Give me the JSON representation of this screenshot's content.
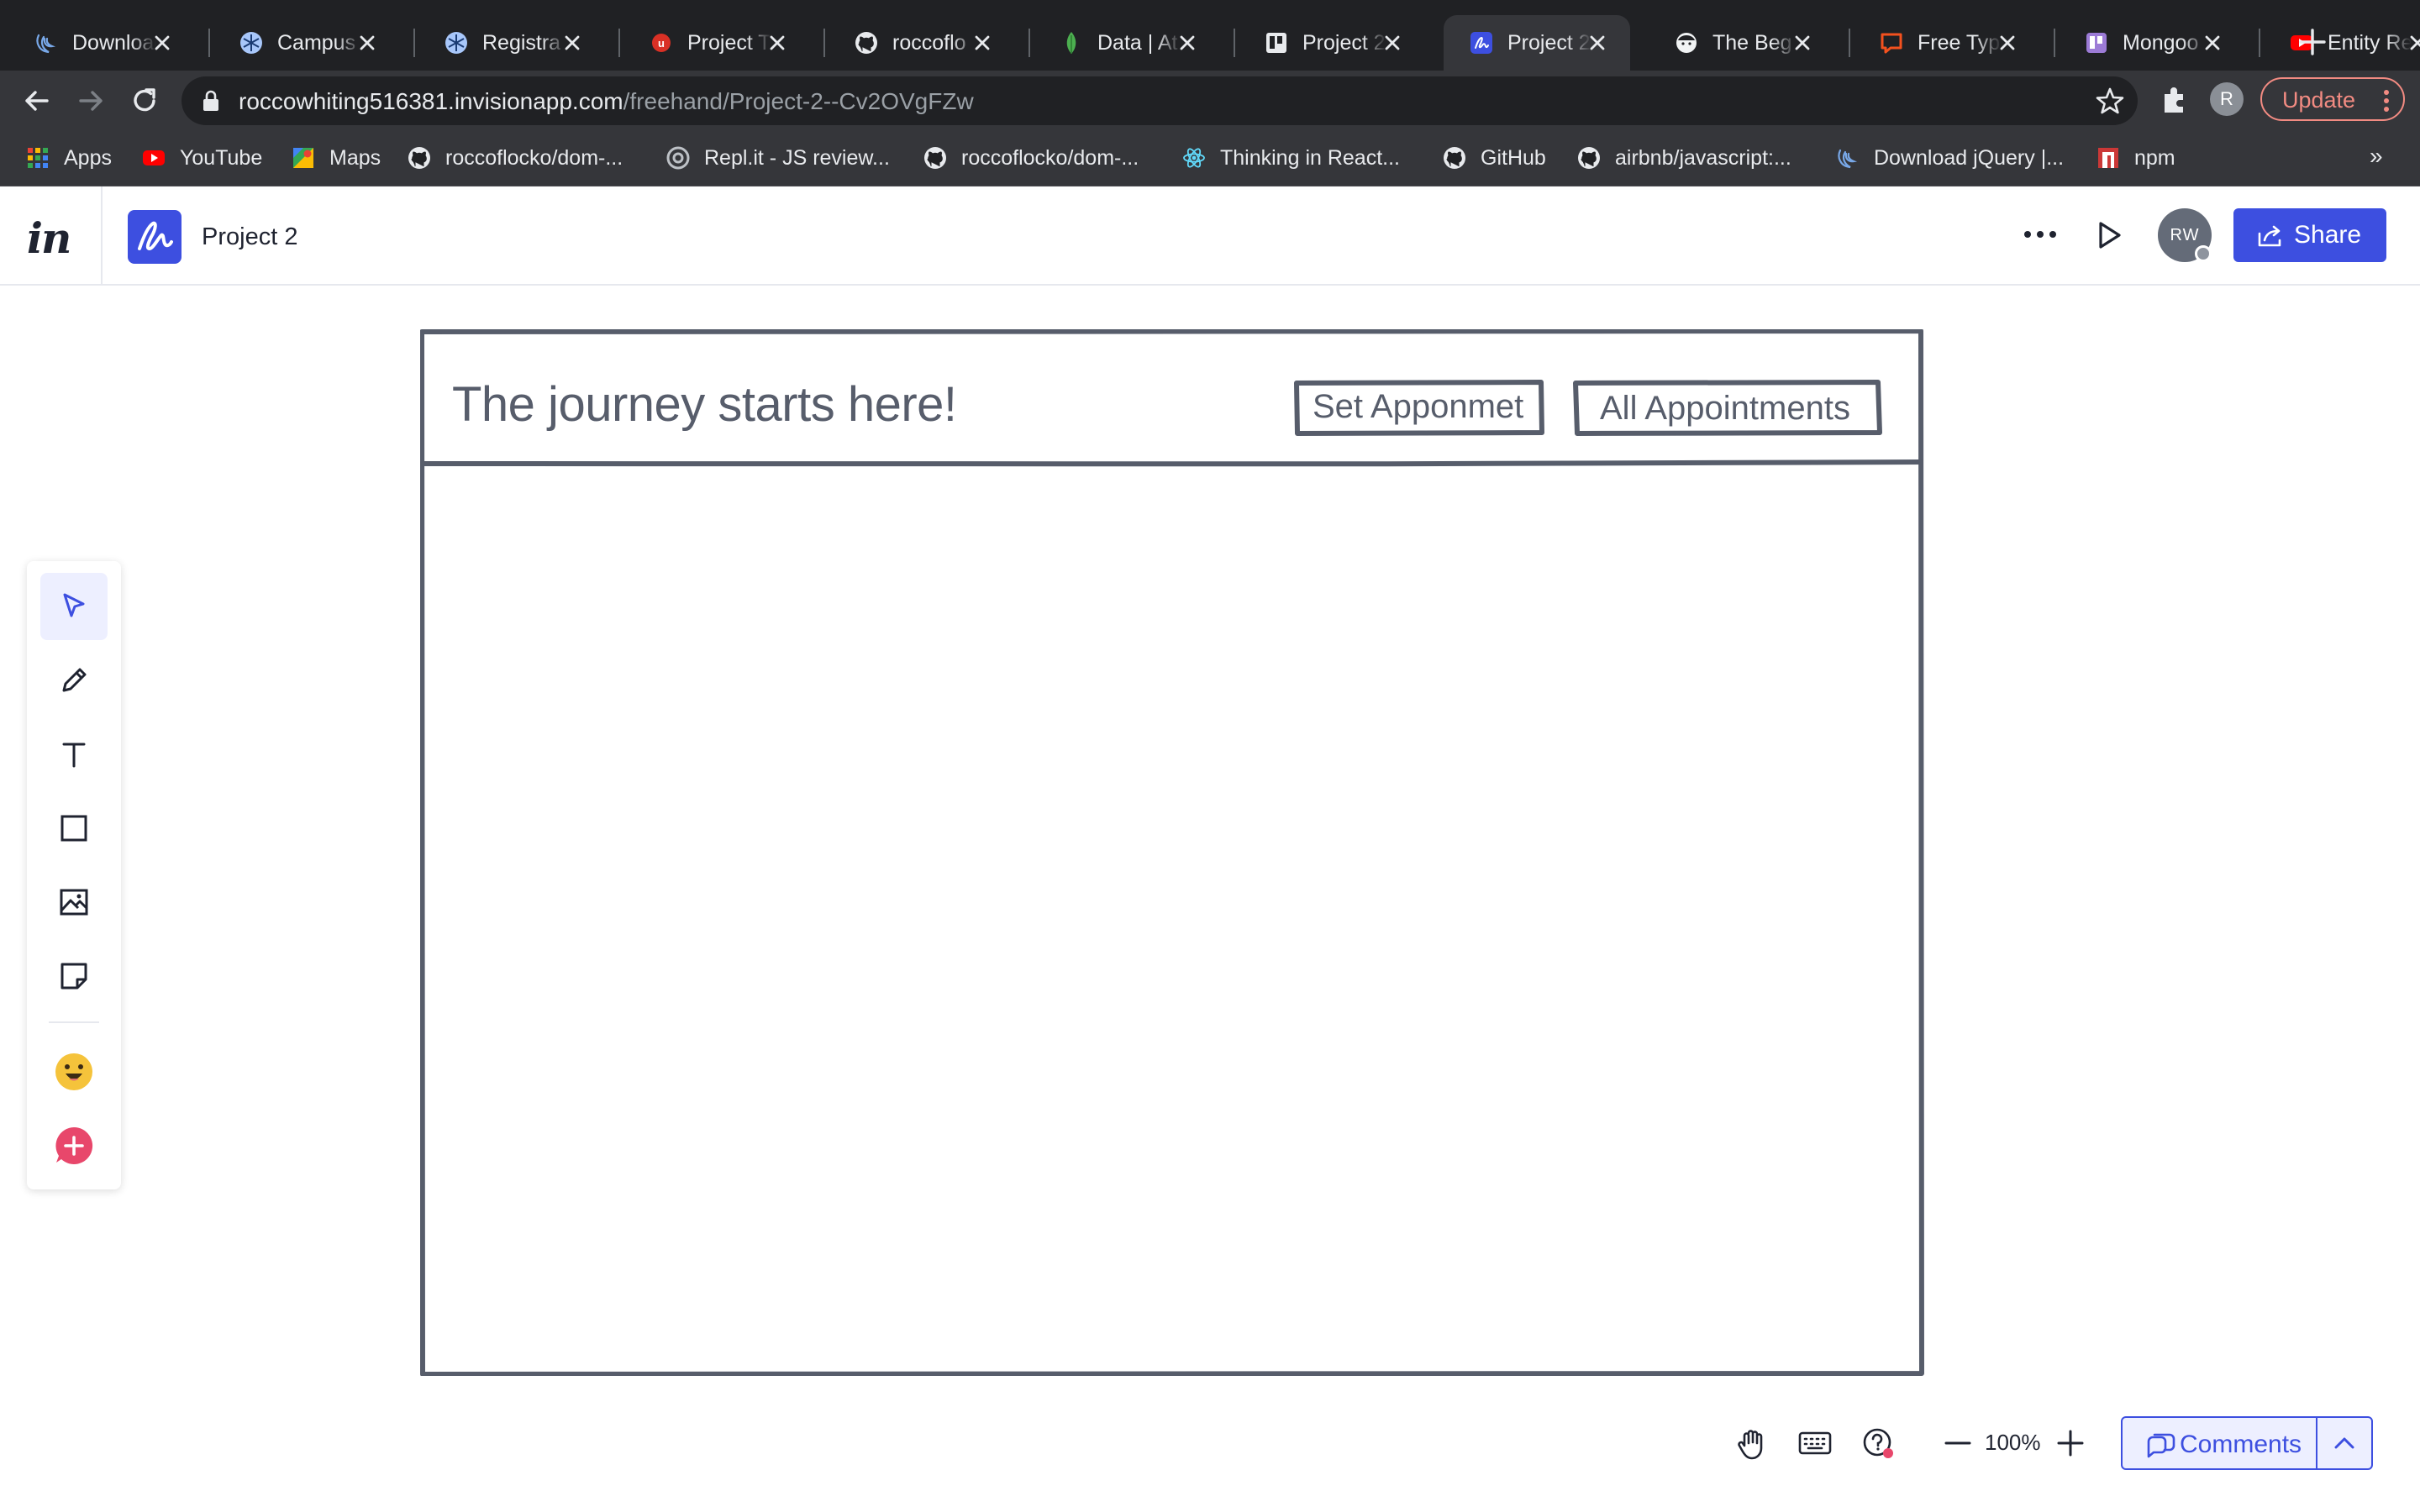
{
  "browser": {
    "tabs": [
      {
        "title": "Download",
        "icon": "jquery-icon",
        "active": false
      },
      {
        "title": "Campus",
        "icon": "snowflake-icon",
        "active": false
      },
      {
        "title": "Registra",
        "icon": "snowflake-icon",
        "active": false
      },
      {
        "title": "Project T",
        "icon": "red-circle-icon",
        "active": false
      },
      {
        "title": "roccoflo",
        "icon": "github-icon",
        "active": false
      },
      {
        "title": "Data | At",
        "icon": "mongodb-leaf-icon",
        "active": false
      },
      {
        "title": "Project 2",
        "icon": "trello-icon",
        "active": false
      },
      {
        "title": "Project 2",
        "icon": "invision-freehand-icon",
        "active": true
      },
      {
        "title": "The Beg",
        "icon": "face-icon",
        "active": false
      },
      {
        "title": "Free Typ",
        "icon": "chat-bubble-icon",
        "active": false
      },
      {
        "title": "Mongoo",
        "icon": "trello-purple-icon",
        "active": false
      },
      {
        "title": "Entity Re",
        "icon": "youtube-icon",
        "active": false
      }
    ],
    "url_domain": "roccowhiting516381.invisionapp.com",
    "url_path": "/freehand/Project-2--Cv2OVgFZw",
    "profile_initial": "R",
    "update_label": "Update",
    "bookmarks": [
      {
        "label": "Apps",
        "icon": "apps-grid-icon"
      },
      {
        "label": "YouTube",
        "icon": "youtube-icon"
      },
      {
        "label": "Maps",
        "icon": "maps-icon"
      },
      {
        "label": "roccoflocko/dom-...",
        "icon": "github-icon"
      },
      {
        "label": "Repl.it - JS review...",
        "icon": "replit-icon"
      },
      {
        "label": "roccoflocko/dom-...",
        "icon": "github-icon"
      },
      {
        "label": "Thinking in React...",
        "icon": "react-icon"
      },
      {
        "label": "GitHub",
        "icon": "github-icon"
      },
      {
        "label": "airbnb/javascript:...",
        "icon": "github-icon"
      },
      {
        "label": "Download jQuery |...",
        "icon": "jquery-icon"
      },
      {
        "label": "npm",
        "icon": "npm-icon"
      }
    ],
    "bookmarks_overflow": "»"
  },
  "app": {
    "logo_text": "in",
    "doc_title": "Project 2",
    "avatar_initials": "RW",
    "share_label": "Share"
  },
  "tools": [
    "select-tool",
    "pen-tool",
    "text-tool",
    "rectangle-tool",
    "image-tool",
    "sticky-note-tool",
    "emoji-tool",
    "add-comment-tool"
  ],
  "canvas": {
    "heading": "The journey starts here!",
    "buttons": [
      "Set Apponmet",
      "All Appointments"
    ]
  },
  "bottom": {
    "zoom": "100%",
    "comments_label": "Comments"
  },
  "colors": {
    "brand": "#3d4fe0",
    "sketch": "#575d6b"
  }
}
